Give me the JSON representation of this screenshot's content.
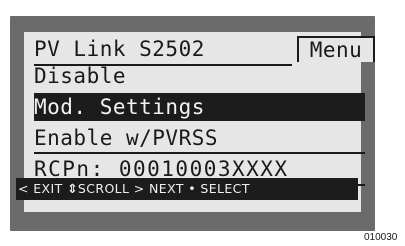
{
  "display": {
    "title": "PV Link S2502",
    "menu_label": "Menu",
    "items": [
      {
        "label": "Disable"
      },
      {
        "label": "Mod. Settings",
        "selected": true
      },
      {
        "label": "Enable w/PVRSS"
      },
      {
        "label": "RCPn: 00010003XXXX"
      }
    ],
    "footer": {
      "exit": "< EXIT",
      "scroll_icon": "up-down-arrow-icon",
      "scroll_glyph": "⇕",
      "scroll": "SCROLL",
      "next": "> NEXT",
      "dot": "•",
      "select": "SELECT"
    }
  },
  "figure_id": "010030",
  "colors": {
    "bezel": "#6b6b6b",
    "screen": "#e6e6e6",
    "highlight": "#1c1c1c",
    "text": "#1a1a1a"
  }
}
